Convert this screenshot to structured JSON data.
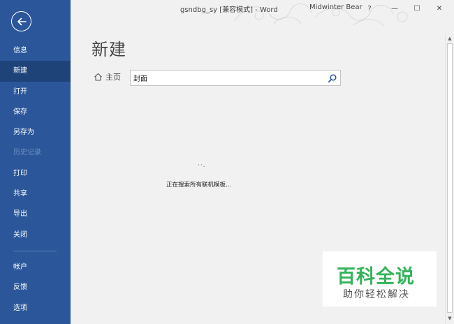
{
  "window": {
    "doc_title": "gsndbg_sy [兼容模式]  -  Word",
    "user_name": "Midwinter Bear",
    "help_label": "?",
    "minimize_label": "—",
    "restore_label": "☐",
    "close_label": "✕"
  },
  "sidebar": {
    "items": [
      {
        "label": "信息"
      },
      {
        "label": "新建"
      },
      {
        "label": "打开"
      },
      {
        "label": "保存"
      },
      {
        "label": "另存为"
      },
      {
        "label": "历史记录"
      },
      {
        "label": "打印"
      },
      {
        "label": "共享"
      },
      {
        "label": "导出"
      },
      {
        "label": "关闭"
      },
      {
        "label": "帐户"
      },
      {
        "label": "反馈"
      },
      {
        "label": "选项"
      }
    ],
    "active_index": 1,
    "disabled_index": 5
  },
  "main": {
    "title": "新建",
    "home_label": "主页",
    "search_value": "封面",
    "loading_dots": "··.",
    "loading_text": "正在搜索所有联机模板..."
  },
  "watermark": {
    "main_text": "百科全说",
    "sub_text": "助你轻松解决"
  },
  "colors": {
    "sidebar_bg": "#2b579a",
    "active_bg": "#1e4379",
    "watermark_green": "#35b35a"
  }
}
